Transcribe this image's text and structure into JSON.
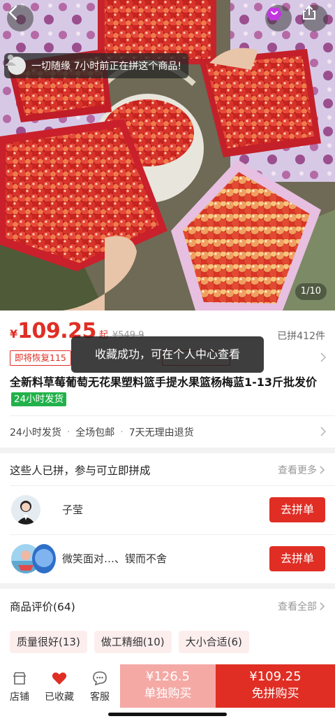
{
  "hero": {
    "image_alt_icon": "cherry-basket-photo",
    "join_toast": "一切随缘 7小时前正在拼这个商品!",
    "counter": "1/10"
  },
  "price": {
    "currency": "¥",
    "value": "109.25",
    "suffix": "起",
    "original": "¥549.9",
    "sold": "已拼412件",
    "promo_tag": "即将恢复115"
  },
  "title": {
    "text": "全新料草莓葡萄无花果塑料篮手提水果篮杨梅蓝1-13斤批发价",
    "badge": "24小时发货"
  },
  "service": {
    "items": [
      "24小时发货",
      "全场包邮",
      "7天无理由退货"
    ]
  },
  "group": {
    "heading": "这些人已拼，参与可立即拼成",
    "more": "查看更多",
    "rows": [
      {
        "name": "子莹",
        "button": "去拼单"
      },
      {
        "name": "微笑面对…、锲而不舍",
        "button": "去拼单"
      }
    ]
  },
  "reviews": {
    "heading": "商品评价(64)",
    "more": "查看全部",
    "chips": [
      "质量很好(13)",
      "做工精细(10)",
      "大小合适(6)"
    ]
  },
  "bottom": {
    "store": "店铺",
    "favorited": "已收藏",
    "service": "客服",
    "solo_price": "¥126.5",
    "solo_label": "单独购买",
    "group_price": "¥109.25",
    "group_label": "免拼购买"
  },
  "toast": {
    "text": "收藏成功，可在个人中心查看"
  },
  "colors": {
    "accent": "#e02e24",
    "green_badge": "#21b14a",
    "solo_button": "#f4a9a5"
  }
}
